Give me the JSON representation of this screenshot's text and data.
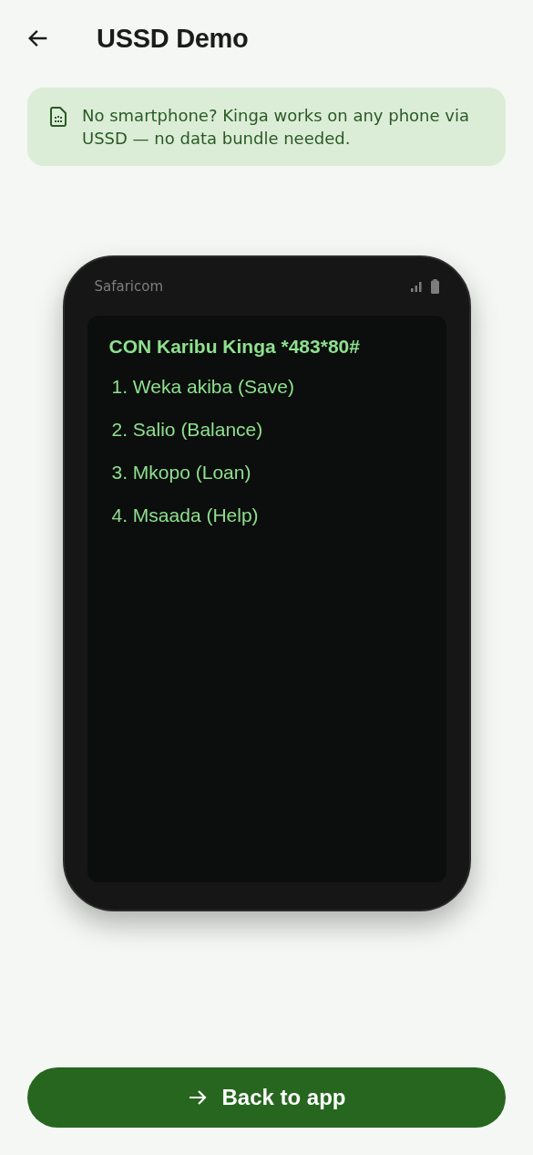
{
  "app_bar": {
    "title": "USSD Demo"
  },
  "info_banner": {
    "text": "No smartphone? Kinga works on any phone via USSD — no data bundle needed."
  },
  "phone": {
    "carrier": "Safaricom",
    "screen": {
      "heading": "CON Karibu Kinga *483*80#",
      "options": [
        "1. Weka akiba (Save)",
        "2. Salio (Balance)",
        "3. Mkopo (Loan)",
        "4. Msaada (Help)"
      ]
    }
  },
  "primary_button": {
    "label": "Back to app"
  }
}
